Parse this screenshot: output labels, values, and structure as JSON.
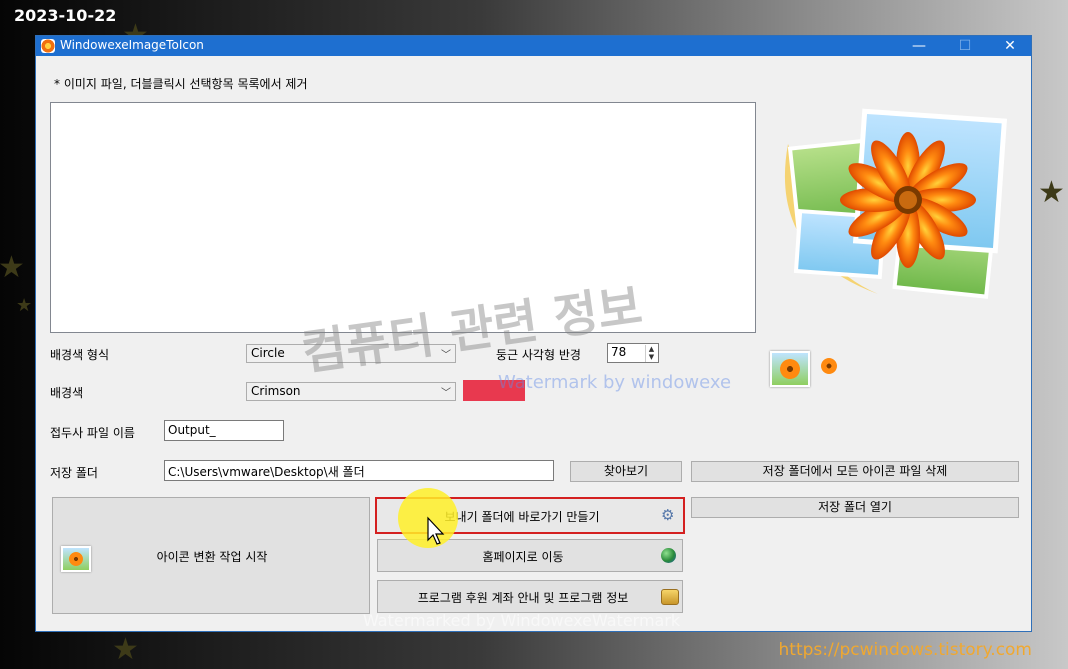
{
  "overlay": {
    "date": "2023-10-22",
    "site": "https://pcwindows.tistory.com",
    "watermark_main": "컴퓨터 관련 정보",
    "watermark_sub": "Watermark by windowexe",
    "watermark_bottom": "Watermarked by WindowexeWatermark"
  },
  "window": {
    "title": "WindowexeImageToIcon",
    "minimize": "—",
    "maximize": "☐",
    "close": "✕"
  },
  "form": {
    "hint": "* 이미지 파일, 더블클릭시 선택항목 목록에서 제거",
    "bg_shape_label": "배경색 형식",
    "bg_shape_value": "Circle",
    "radius_label": "둥근 사각형 반경",
    "radius_value": "78",
    "bg_color_label": "배경색",
    "bg_color_value": "Crimson",
    "bg_color_swatch": "#e8394f",
    "prefix_label": "접두사 파일 이름",
    "prefix_value": "Output_",
    "folder_label": "저장 폴더",
    "folder_value": "C:\\Users\\vmware\\Desktop\\새 폴더"
  },
  "buttons": {
    "browse": "찾아보기",
    "delete_all": "저장 폴더에서 모든 아이콘 파일 삭제",
    "open_folder": "저장 폴더 열기",
    "start": "아이콘 변환 작업 시작",
    "sendto": "보내기 폴더에 바로가기 만들기",
    "homepage": "홈페이지로 이동",
    "info": "프로그램 후원 계좌 안내 및 프로그램 정보"
  },
  "icons": {
    "sendto": "gear-icon",
    "homepage": "globe-icon",
    "info": "coins-icon",
    "start": "image-icon"
  }
}
